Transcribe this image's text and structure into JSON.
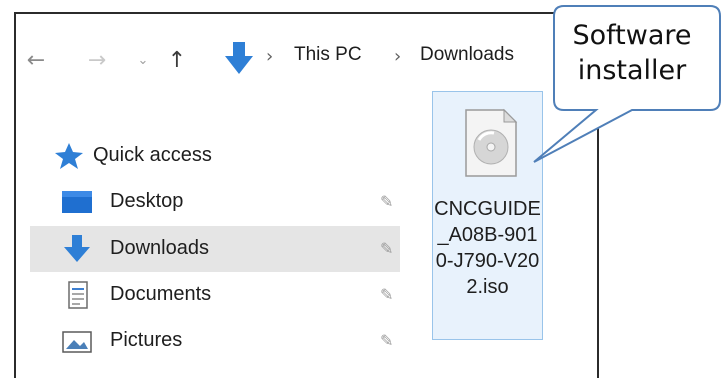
{
  "breadcrumb": {
    "items": [
      "This PC",
      "Downloads"
    ],
    "separator": "›"
  },
  "nav": {
    "back_glyph": "←",
    "forward_glyph": "→",
    "recent_glyph": "⌄",
    "up_glyph": "↑"
  },
  "sidebar": {
    "items": [
      {
        "label": "Quick access",
        "icon": "star-icon"
      },
      {
        "label": "Desktop",
        "icon": "desktop-icon",
        "pinned": true
      },
      {
        "label": "Downloads",
        "icon": "download-arrow-icon",
        "pinned": true,
        "selected": true
      },
      {
        "label": "Documents",
        "icon": "documents-icon",
        "pinned": true
      },
      {
        "label": "Pictures",
        "icon": "pictures-icon",
        "pinned": true
      }
    ]
  },
  "file": {
    "name": "CNCGUIDE_A08B-9010-J790-V202.iso",
    "icon": "disc-image-file-icon"
  },
  "callout": {
    "line1": "Software",
    "line2": "installer"
  },
  "colors": {
    "accent_blue": "#2e7fd6",
    "selection_bg": "#e5e5e5",
    "file_selected_bg": "#e8f2fc",
    "file_selected_border": "#99c4ea",
    "callout_border": "#4f7fb8"
  }
}
